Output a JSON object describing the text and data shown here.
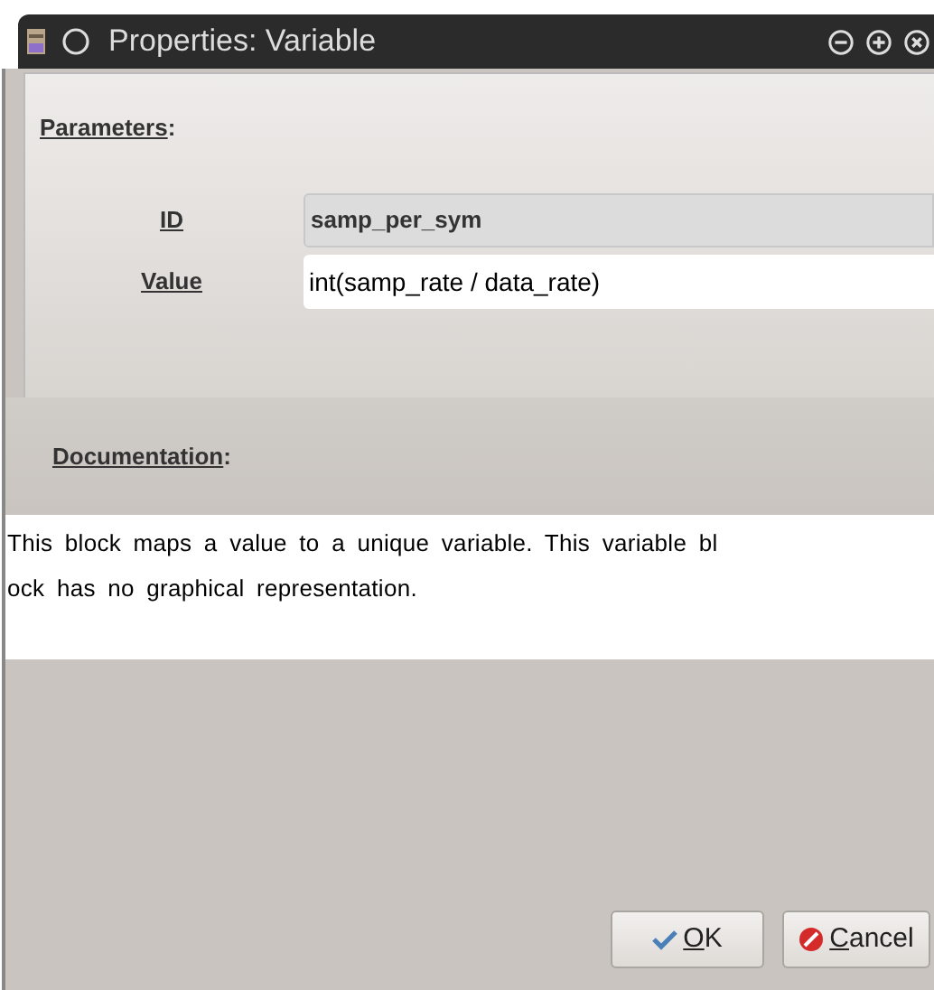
{
  "window": {
    "title": "Properties: Variable"
  },
  "parameters": {
    "heading": "Parameters",
    "heading_suffix": ":",
    "fields": [
      {
        "label": "ID",
        "value": "samp_per_sym",
        "editable": false
      },
      {
        "label": "Value",
        "value": "int(samp_rate / data_rate)",
        "editable": true
      }
    ]
  },
  "documentation": {
    "heading": "Documentation",
    "heading_suffix": ":",
    "lines": [
      "This block maps a value to a unique variable. This variable bl",
      "ock has no graphical representation."
    ]
  },
  "buttons": [
    {
      "kind": "ok",
      "mnemonic": "O",
      "rest": "K"
    },
    {
      "kind": "cancel",
      "mnemonic": "C",
      "rest": "ancel"
    }
  ]
}
